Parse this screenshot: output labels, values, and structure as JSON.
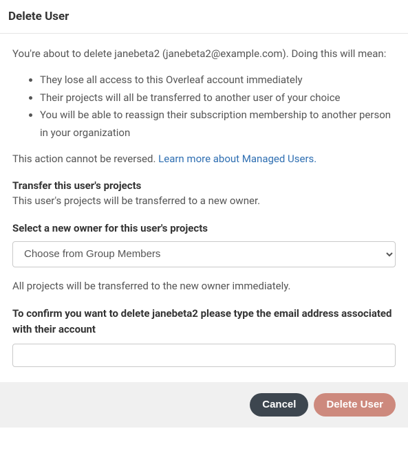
{
  "header": {
    "title": "Delete User"
  },
  "body": {
    "intro": "You're about to delete janebeta2 (janebeta2@example.com). Doing this will mean:",
    "bullets": [
      "They lose all access to this Overleaf account immediately",
      "Their projects will all be transferred to another user of your choice",
      "You will be able to reassign their subscription membership to another person in your organization"
    ],
    "irrevocable_prefix": "This action cannot be reversed. ",
    "learn_more_link": "Learn more about Managed Users.",
    "transfer_title": "Transfer this user's projects",
    "transfer_desc": "This user's projects will be transferred to a new owner.",
    "select_label": "Select a new owner for this user's projects",
    "select_placeholder": "Choose from Group Members",
    "transfer_note": "All projects will be transferred to the new owner immediately.",
    "confirm_label": "To confirm you want to delete janebeta2 please type the email address associated with their account",
    "confirm_value": ""
  },
  "footer": {
    "cancel_label": "Cancel",
    "delete_label": "Delete User"
  }
}
